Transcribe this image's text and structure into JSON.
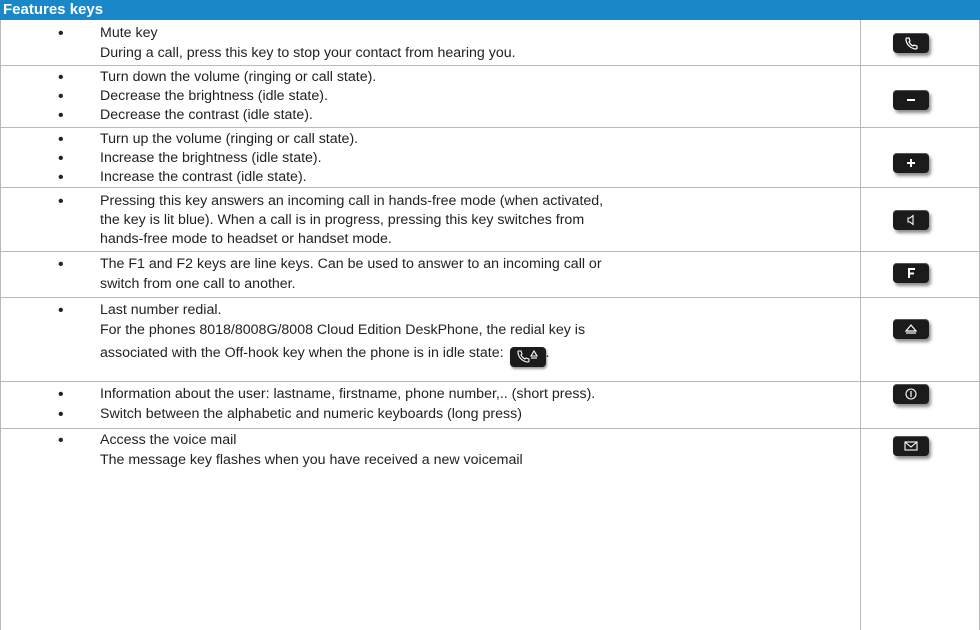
{
  "header": {
    "title": "Features keys"
  },
  "rows": [
    {
      "lines": [
        "Mute key",
        "During a call, press this key to stop your contact from hearing you."
      ],
      "icon": "handset-icon"
    },
    {
      "lines": [
        "Turn down the volume (ringing or call state).",
        "Decrease the brightness (idle state).",
        "Decrease the contrast (idle state)."
      ],
      "icon": "minus-icon"
    },
    {
      "lines": [
        "Turn up the volume (ringing or call state).",
        "Increase the brightness (idle state).",
        "Increase the contrast (idle state)."
      ],
      "icon": "plus-icon"
    },
    {
      "lines": [
        "Pressing this key answers an incoming call in hands-free mode (when activated,",
        "the key is lit blue). When a call is in progress, pressing this key switches from",
        "hands-free mode to headset or handset mode."
      ],
      "icon": "speaker-icon"
    },
    {
      "lines": [
        "The F1 and F2 keys are line keys. Can be used to answer to an incoming call or",
        "switch from one call to another."
      ],
      "icon": "f-key-icon"
    },
    {
      "lines": [
        "Last number redial.",
        "For the phones 8018/8008G/8008 Cloud Edition DeskPhone, the redial key is",
        "associated with the Off-hook key when the phone is in idle state:",
        "."
      ],
      "icon": "redial-icon"
    },
    {
      "lines": [
        "Information about the user: lastname, firstname, phone number,.. (short press).",
        "Switch between the alphabetic and numeric keyboards (long press)"
      ],
      "icon": "info-icon"
    },
    {
      "lines": [
        "Access the voice mail",
        "The message key flashes when you have received a new voicemail"
      ],
      "icon": "mail-icon"
    }
  ]
}
